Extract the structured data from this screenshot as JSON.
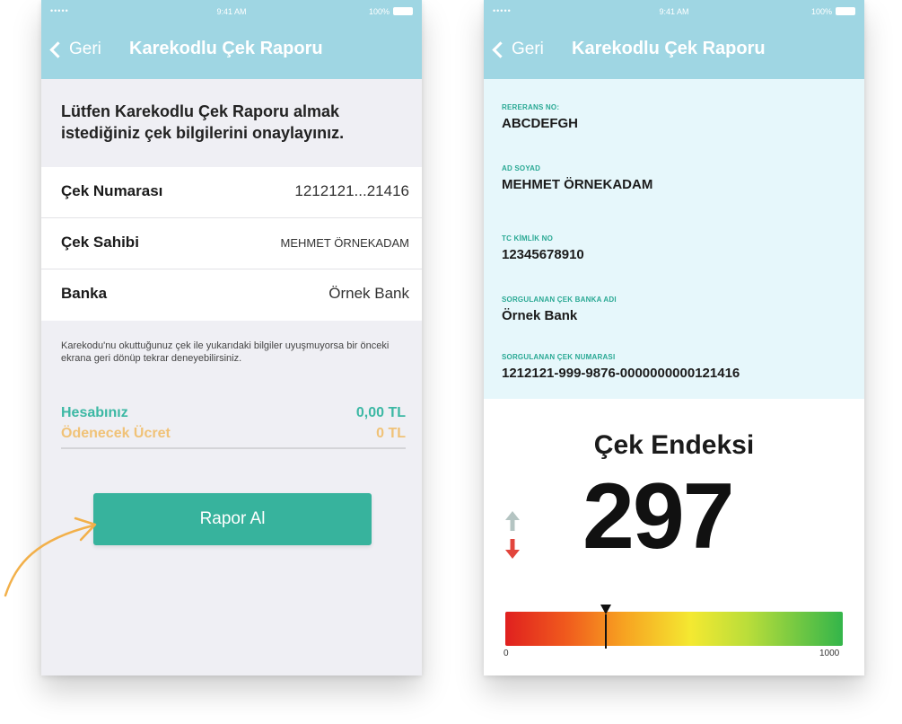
{
  "status_bar": {
    "signal": "•••••",
    "time": "9:41 AM",
    "battery": "100%"
  },
  "left_screen": {
    "nav": {
      "back_label": "Geri",
      "title": "Karekodlu Çek Raporu"
    },
    "prompt": "Lütfen Karekodlu Çek Raporu almak istediğiniz çek bilgilerini onaylayınız.",
    "rows": [
      {
        "label": "Çek Numarası",
        "value": "1212121...21416"
      },
      {
        "label": "Çek Sahibi",
        "value": "MEHMET ÖRNEKADAM"
      },
      {
        "label": "Banka",
        "value": "Örnek Bank"
      }
    ],
    "note": "Karekodu'nu okuttuğunuz çek ile yukarıdaki bilgiler uyuşmuyorsa bir önceki ekrana geri dönüp tekrar deneyebilirsiniz.",
    "balance": {
      "label": "Hesabınız",
      "value": "0,00 TL"
    },
    "fee": {
      "label": "Ödenecek Ücret",
      "value": "0 TL"
    },
    "report_button": "Rapor Al"
  },
  "right_screen": {
    "nav": {
      "back_label": "Geri",
      "title": "Karekodlu Çek Raporu"
    },
    "fields": [
      {
        "caption": "RERERANS NO:",
        "value": "ABCDEFGH"
      },
      {
        "caption": "AD SOYAD",
        "value": "MEHMET ÖRNEKADAM"
      },
      {
        "caption": "TC KİMLİK NO",
        "value": "12345678910"
      },
      {
        "caption": "SORGULANAN ÇEK BANKA ADI",
        "value": "Örnek Bank"
      },
      {
        "caption": "SORGULANAN ÇEK NUMARASI",
        "value": "1212121-999-9876-0000000000121416"
      }
    ],
    "index": {
      "title": "Çek Endeksi",
      "value": "297",
      "min_label": "0",
      "max_label": "1000",
      "gauge_value": 297,
      "gauge_max": 1000
    }
  },
  "colors": {
    "nav_bg": "#9fd6e3",
    "accent_teal": "#37b39d",
    "balance_teal": "#3cb8a4",
    "fee_orange": "#f0c277",
    "detail_bg": "#e6f7fb",
    "arrow_up": "#b4c4c2",
    "arrow_down": "#e2453c",
    "pointer_arrow": "#f2b04a"
  },
  "icons": {
    "back": "chevron-left-icon",
    "trend_up": "arrow-up-icon",
    "trend_down": "arrow-down-icon",
    "pointer": "curved-arrow-icon"
  }
}
